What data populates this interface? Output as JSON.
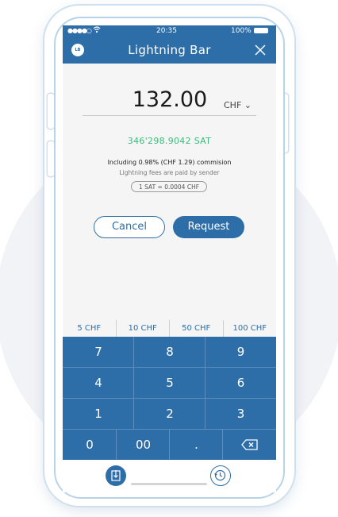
{
  "status_bar": {
    "signal": "●●●●○",
    "time": "20:35",
    "battery": "100%"
  },
  "nav": {
    "logo": "LB",
    "title": "Lightning Bar",
    "close_icon": "close-icon"
  },
  "amount": {
    "value": "132.00",
    "currency": "CHF ⌄"
  },
  "conversion": {
    "sat": "346'298.9042  SAT",
    "commission": "Including 0.98% (CHF 1.29) commision",
    "fees_note": "Lightning fees are paid by sender",
    "rate": "1 SAT = 0.0004 CHF"
  },
  "actions": {
    "cancel": "Cancel",
    "request": "Request"
  },
  "quick_amounts": [
    "5 CHF",
    "10 CHF",
    "50 CHF",
    "100 CHF"
  ],
  "keypad": {
    "row1": [
      "7",
      "8",
      "9"
    ],
    "row2": [
      "4",
      "5",
      "6"
    ],
    "row3": [
      "1",
      "2",
      "3"
    ],
    "row4": [
      "0",
      "00",
      ".",
      "backspace-icon"
    ]
  },
  "bottom_bar": {
    "left_icon": "download-icon",
    "right_icon": "history-icon"
  },
  "colors": {
    "primary": "#2d6ea8",
    "sat_green": "#3dbb7e",
    "background": "#f5f5f5"
  }
}
